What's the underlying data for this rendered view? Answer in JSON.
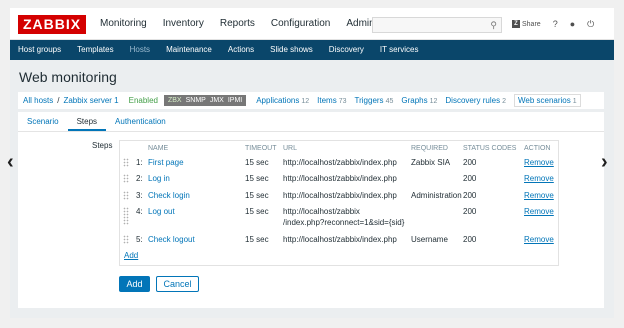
{
  "header": {
    "logo": "ZABBIX",
    "nav": [
      "Monitoring",
      "Inventory",
      "Reports",
      "Configuration",
      "Administrat"
    ],
    "search_placeholder": "",
    "share_label": "Share",
    "help_icon": "?",
    "user_icon": "user-icon",
    "power_icon": "power-icon"
  },
  "subnav": [
    "Host groups",
    "Templates",
    "Hosts",
    "Maintenance",
    "Actions",
    "Slide shows",
    "Discovery",
    "IT services"
  ],
  "page_title": "Web monitoring",
  "breadcrumbs": {
    "all_hosts": "All hosts",
    "host": "Zabbix server 1",
    "enabled": "Enabled",
    "tags": [
      "ZBX",
      "SNMP",
      "JMX",
      "IPMI"
    ],
    "links": [
      {
        "label": "Applications",
        "count": "12"
      },
      {
        "label": "Items",
        "count": "73"
      },
      {
        "label": "Triggers",
        "count": "45"
      },
      {
        "label": "Graphs",
        "count": "12"
      },
      {
        "label": "Discovery rules",
        "count": "2"
      }
    ],
    "web_scenarios": {
      "label": "Web scenarios",
      "count": "1"
    }
  },
  "tabs": [
    "Scenario",
    "Steps",
    "Authentication"
  ],
  "steps": {
    "label": "Steps",
    "columns": [
      "NAME",
      "TIMEOUT",
      "URL",
      "REQUIRED",
      "STATUS CODES",
      "ACTION"
    ],
    "rows": [
      {
        "num": "1:",
        "name": "First page",
        "timeout": "15 sec",
        "url": "http://localhost/zabbix/index.php",
        "url2": "",
        "required": "Zabbix SIA",
        "status": "200",
        "action": "Remove"
      },
      {
        "num": "2:",
        "name": "Log in",
        "timeout": "15 sec",
        "url": "http://localhost/zabbix/index.php",
        "url2": "",
        "required": "",
        "status": "200",
        "action": "Remove"
      },
      {
        "num": "3:",
        "name": "Check login",
        "timeout": "15 sec",
        "url": "http://localhost/zabbix/index.php",
        "url2": "",
        "required": "Administration",
        "status": "200",
        "action": "Remove"
      },
      {
        "num": "4:",
        "name": "Log out",
        "timeout": "15 sec",
        "url": "http://localhost/zabbix",
        "url2": "/index.php?reconnect=1&sid={sid}",
        "required": "",
        "status": "200",
        "action": "Remove"
      },
      {
        "num": "5:",
        "name": "Check logout",
        "timeout": "15 sec",
        "url": "http://localhost/zabbix/index.php",
        "url2": "",
        "required": "Username",
        "status": "200",
        "action": "Remove"
      }
    ],
    "add_label": "Add"
  },
  "buttons": {
    "add": "Add",
    "cancel": "Cancel"
  },
  "slider": {
    "prev": "‹",
    "next": "›"
  }
}
